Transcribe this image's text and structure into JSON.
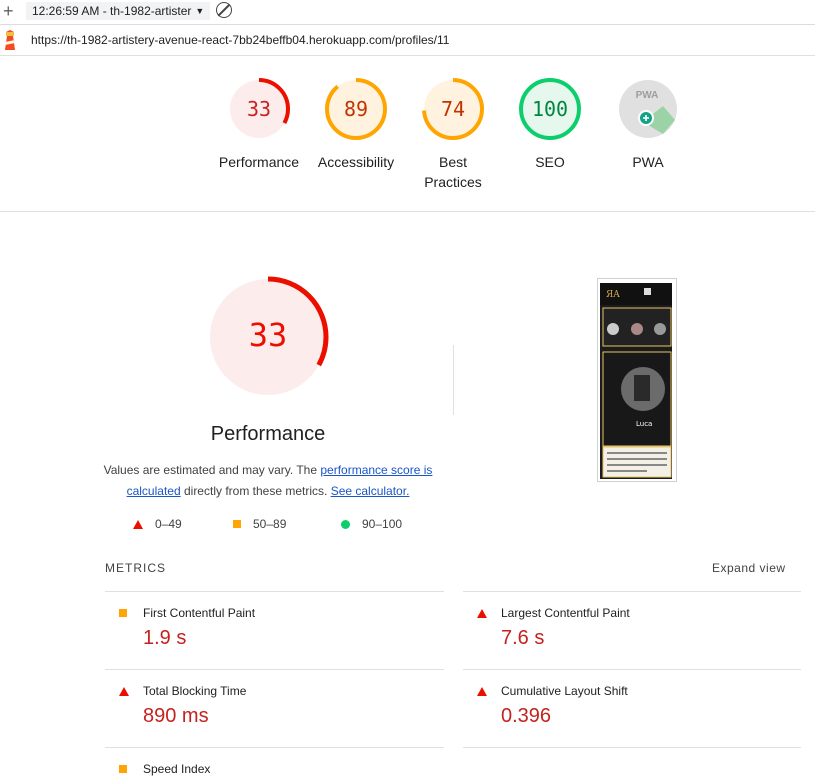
{
  "browser": {
    "tab_title": "12:26:59 AM - th-1982-artister",
    "url": "https://th-1982-artistery-avenue-react-7bb24beffb04.herokuapp.com/profiles/11"
  },
  "gauges": [
    {
      "label": "Performance",
      "score": "33",
      "value": 33,
      "color": "#eb0f00",
      "bg": "#fdecec"
    },
    {
      "label": "Accessibility",
      "score": "89",
      "value": 89,
      "color": "#ffa400",
      "bg": "#fff3e0"
    },
    {
      "label": "Best Practices",
      "score": "74",
      "value": 74,
      "color": "#ffa400",
      "bg": "#fff3e0"
    },
    {
      "label": "SEO",
      "score": "100",
      "value": 100,
      "color": "#0cce6b",
      "bg": "#e6f7ee"
    },
    {
      "label": "PWA",
      "score": "PWA",
      "value": 0,
      "color": "#9e9e9e",
      "bg": "#e0e0e0"
    }
  ],
  "performance": {
    "score": "33",
    "title": "Performance",
    "desc_prefix": "Values are estimated and may vary. The ",
    "link_score": "performance score is calculated",
    "desc_mid": " directly from these metrics. ",
    "link_calc": "See calculator."
  },
  "legend": [
    {
      "range": "0–49",
      "shape": "triangle",
      "color": "#eb0f00"
    },
    {
      "range": "50–89",
      "shape": "square",
      "color": "#ffa400"
    },
    {
      "range": "90–100",
      "shape": "circle",
      "color": "#0cce6b"
    }
  ],
  "metrics": {
    "heading": "METRICS",
    "expand": "Expand view",
    "items": [
      {
        "title": "First Contentful Paint",
        "value": "1.9 s",
        "shape": "square"
      },
      {
        "title": "Largest Contentful Paint",
        "value": "7.6 s",
        "shape": "triangle"
      },
      {
        "title": "Total Blocking Time",
        "value": "890 ms",
        "shape": "triangle"
      },
      {
        "title": "Cumulative Layout Shift",
        "value": "0.396",
        "shape": "triangle"
      },
      {
        "title": "Speed Index",
        "value": "",
        "shape": "square"
      }
    ]
  },
  "thumbnail": {
    "profile_name": "Luca"
  }
}
